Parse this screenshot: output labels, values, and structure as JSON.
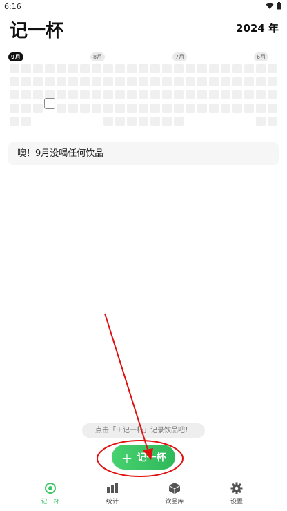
{
  "status_bar": {
    "time": "6:16",
    "icons": [
      "wifi-icon",
      "battery-icon"
    ]
  },
  "header": {
    "title": "记一杯",
    "year": "2024 年"
  },
  "calendar": {
    "months": [
      {
        "label": "9月",
        "active": true
      },
      {
        "label": "8月",
        "active": false
      },
      {
        "label": "7月",
        "active": false
      },
      {
        "label": "6月",
        "active": false
      }
    ]
  },
  "empty_message": "噢！9月没喝任何饮品",
  "hint": "点击「＋记一杯」记录饮品吧！",
  "add_button": {
    "label": "记一杯",
    "icon": "plus-icon"
  },
  "tabs": [
    {
      "label": "记一杯",
      "icon": "record-icon",
      "active": true
    },
    {
      "label": "统计",
      "icon": "bar-chart-icon",
      "active": false
    },
    {
      "label": "饮品库",
      "icon": "box-icon",
      "active": false
    },
    {
      "label": "设置",
      "icon": "gear-icon",
      "active": false
    }
  ],
  "colors": {
    "accent": "#3cc466",
    "annotation": "#e01010"
  }
}
